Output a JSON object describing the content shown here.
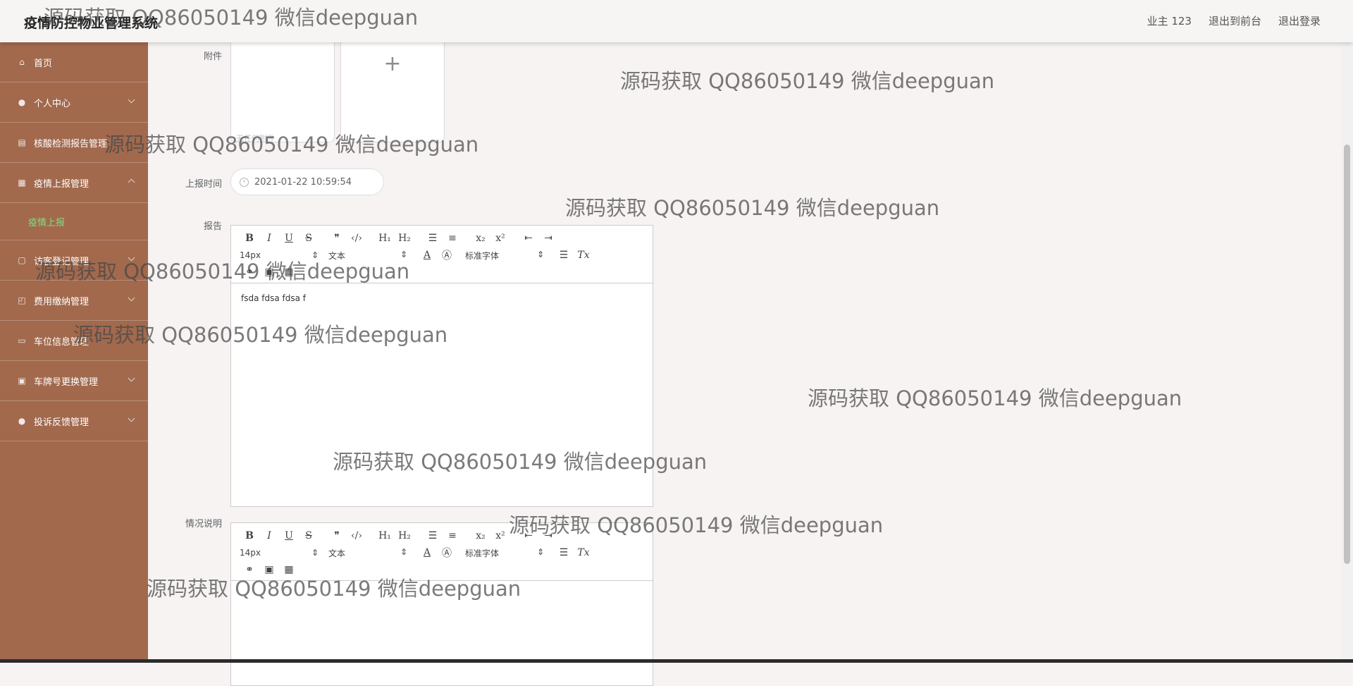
{
  "header": {
    "app_title": "疫情防控物业管理系统",
    "links": [
      "业主 123",
      "退出到前台",
      "退出登录"
    ]
  },
  "sidebar": {
    "items": [
      {
        "label": "首页",
        "icon": "home-icon"
      },
      {
        "label": "个人中心",
        "icon": "user-icon"
      },
      {
        "label": "核酸检测报告管理",
        "icon": "clipboard-icon"
      },
      {
        "label": "疫情上报管理",
        "icon": "report-icon"
      },
      {
        "label": "访客登记管理",
        "icon": "visitor-icon"
      },
      {
        "label": "费用缴纳管理",
        "icon": "fee-icon"
      },
      {
        "label": "车位信息管理",
        "icon": "parking-icon"
      },
      {
        "label": "车牌号更换管理",
        "icon": "car-icon"
      },
      {
        "label": "投诉反馈管理",
        "icon": "feedback-icon"
      }
    ],
    "active_sub": "疫情上报"
  },
  "form": {
    "attachment_label": "附件",
    "upload_plus": "+",
    "report_time_label": "上报时间",
    "report_time_value": "2021-01-22 10:59:54",
    "report_label": "报告",
    "report_content": "fsda fdsa fdsa f",
    "situation_label": "情况说明",
    "hint": "无任何附件"
  },
  "editor_toolbar": {
    "font_size": "14px",
    "text_type": "文本",
    "font_family": "标准字体"
  },
  "watermark": "源码获取 QQ86050149 微信deepguan",
  "colors": {
    "sidebar_bg": "#a2694d",
    "active_submenu": "#7ee07e",
    "page_bg": "#f6f3f2"
  }
}
